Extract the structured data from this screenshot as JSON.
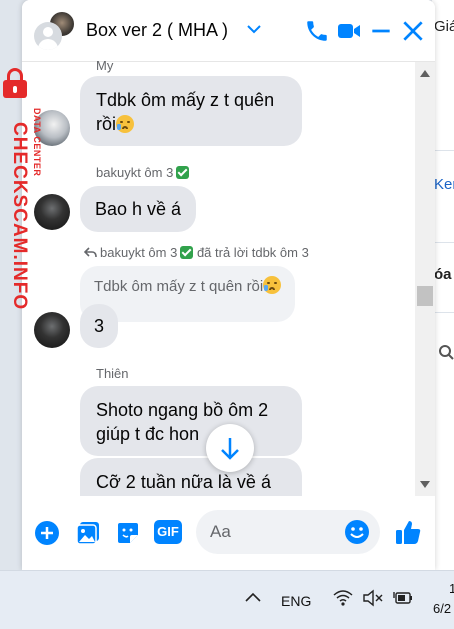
{
  "background_app": {
    "fragments": [
      "Giá",
      "Ker",
      "óa"
    ]
  },
  "watermark": {
    "brand": "CHECKSCAM.INFO",
    "tagline": "DATA CENTER"
  },
  "chat": {
    "title": "Box ver 2 ( MHA )",
    "header_icons": [
      "chevron-down-icon",
      "phone-icon",
      "video-icon",
      "minimize-icon",
      "close-icon"
    ],
    "accent_color": "#0084ff",
    "messages": {
      "sender_top": "My",
      "msg1": "Tdbk ôm mấy z t quên",
      "msg1_line2": "rồi",
      "sender2": "bakuykt ôm 3",
      "msg2": "Bao h về á",
      "reply_header": "bakuykt ôm 3",
      "reply_suffix": "đã trả lời tdbk ôm 3",
      "quote": "Tdbk ôm mấy z t quên rồi",
      "msg3": "3",
      "sender3": "Thiên",
      "msg4_line1": "Shoto ngang bồ ôm 2",
      "msg4_line2": "giúp t đc hon",
      "msg5": "Cỡ 2 tuần nữa là về á"
    },
    "composer": {
      "placeholder": "Aa",
      "icons": [
        "plus-icon",
        "image-icon",
        "sticker-icon",
        "gif-icon",
        "emoji-icon",
        "thumbs-up-icon"
      ],
      "gif_label": "GIF"
    }
  },
  "taskbar": {
    "language": "ENG",
    "time_fragment": "1",
    "date_fragment": "6/2",
    "icons": [
      "chevron-up-icon",
      "wifi-icon",
      "speaker-muted-icon",
      "battery-icon"
    ]
  }
}
